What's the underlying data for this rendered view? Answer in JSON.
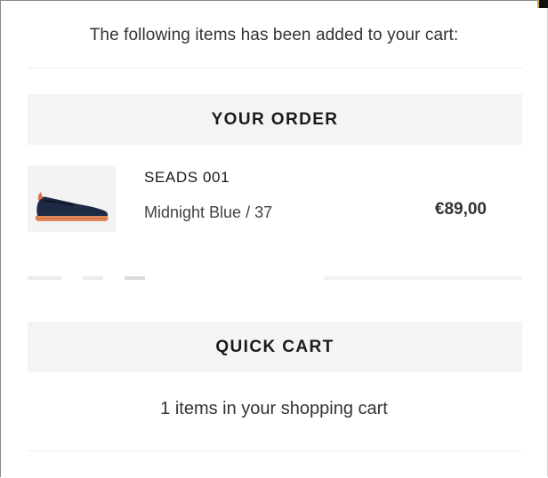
{
  "notice": {
    "message": "The following items has been added to your cart:"
  },
  "order_section": {
    "title": "YOUR ORDER",
    "items": [
      {
        "name": "SEADS 001",
        "variant": "Midnight Blue / 37",
        "price": "€89,00",
        "image_icon": "espadrille-shoe-image"
      }
    ]
  },
  "quick_cart": {
    "title": "QUICK CART",
    "summary": "1 items in your shopping cart"
  },
  "colors": {
    "section_bar": "#f4f4f4",
    "shoe_upper": "#1c2a44",
    "shoe_sole": "#e0895a",
    "divider": "#ececec"
  }
}
